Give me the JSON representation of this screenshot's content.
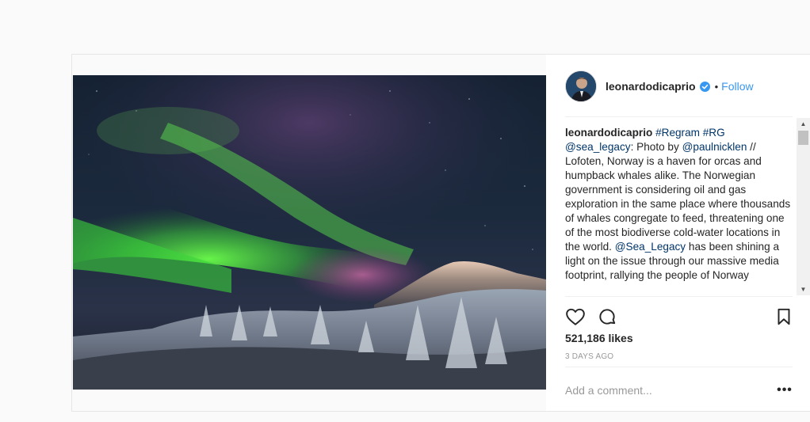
{
  "post": {
    "username": "leonardodicaprio",
    "verified": true,
    "dot": "•",
    "follow_label": "Follow",
    "photo_alt": "aurora",
    "caption": {
      "user": "leonardodicaprio",
      "tags_inline": "#Regram #RG",
      "mention1": "@sea_legacy",
      "text1": ": Photo by ",
      "mention2": "@paulnicklen",
      "text2": " // Lofoten, Norway is a haven for orcas and humpback whales alike. The Norwegian government is considering oil and gas exploration in the same place where thousands of whales congregate to feed, threatening one of the most biodiverse cold-water locations in the world. ",
      "mention3": "@Sea_Legacy",
      "text3": " has been shining a light on the issue through our massive media footprint, rallying the people of Norway"
    },
    "likes": "521,186 likes",
    "time": "3 DAYS AGO",
    "comment_placeholder": "Add a comment...",
    "more_label": "•••",
    "icons": {
      "like": "heart-icon",
      "comment": "comment-icon",
      "save": "bookmark-icon",
      "verified": "verified-badge-icon"
    },
    "colors": {
      "link": "#3897f0",
      "tag": "#003569",
      "verified": "#3897f0"
    }
  }
}
